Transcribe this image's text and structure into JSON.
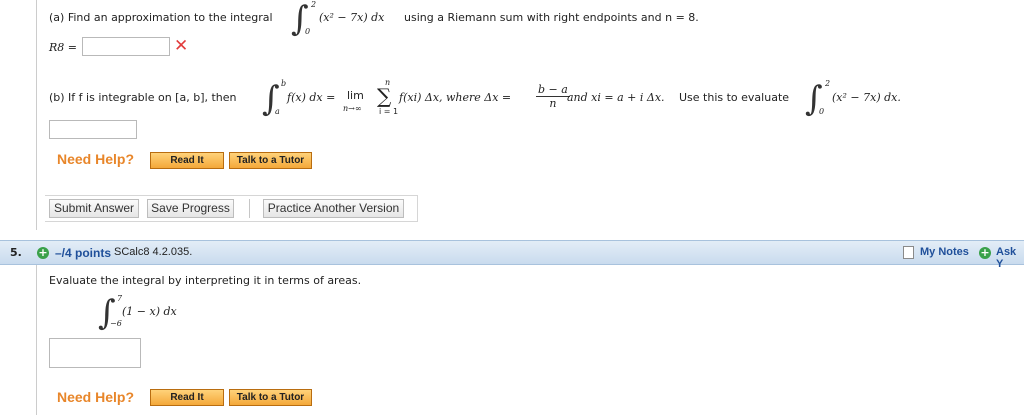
{
  "q4": {
    "part_a": {
      "prefix": "(a) Find an approximation to the integral",
      "int_upper": "2",
      "int_lower": "0",
      "integrand": "(x² − 7x) dx",
      "suffix": "using a Riemann sum with right endpoints and n = 8.",
      "answer_label": "R8 =",
      "answer_value": "",
      "status": "incorrect",
      "status_color": "#e23b3b"
    },
    "part_b": {
      "prefix": "(b) If f is integrable on [a, b], then",
      "int_upper": "b",
      "int_lower": "a",
      "integrand": "f(x) dx =",
      "lim": "lim",
      "lim_sub": "n→∞",
      "sum_upper": "n",
      "sum_lower": "i = 1",
      "sum_term": "f(xi) Δx, where Δx =",
      "frac_num": "b − a",
      "frac_den": "n",
      "after_frac": "and xi = a + i Δx.",
      "evaluate_text": "Use this to evaluate",
      "eval_upper": "2",
      "eval_lower": "0",
      "eval_integrand": "(x² − 7x) dx.",
      "answer_value": ""
    },
    "need_help": "Need Help?",
    "read_it": "Read It",
    "talk_tutor": "Talk to a Tutor",
    "submit": "Submit Answer",
    "save": "Save Progress",
    "practice": "Practice Another Version"
  },
  "q5": {
    "number": "5.",
    "points": "–/4 points",
    "source": "SCalc8 4.2.035.",
    "my_notes": "My Notes",
    "ask": "Ask Y",
    "prompt": "Evaluate the integral by interpreting it in terms of areas.",
    "int_upper": "7",
    "int_lower": "−6",
    "integrand": "(1 − x) dx",
    "answer_value": "",
    "need_help": "Need Help?",
    "read_it": "Read It",
    "talk_tutor": "Talk to a Tutor"
  },
  "colors": {
    "accent_orange": "#e8862a",
    "bar_blue": "#c9dbee",
    "link_blue": "#1f4f9a",
    "green_plus": "#3aa14a"
  }
}
